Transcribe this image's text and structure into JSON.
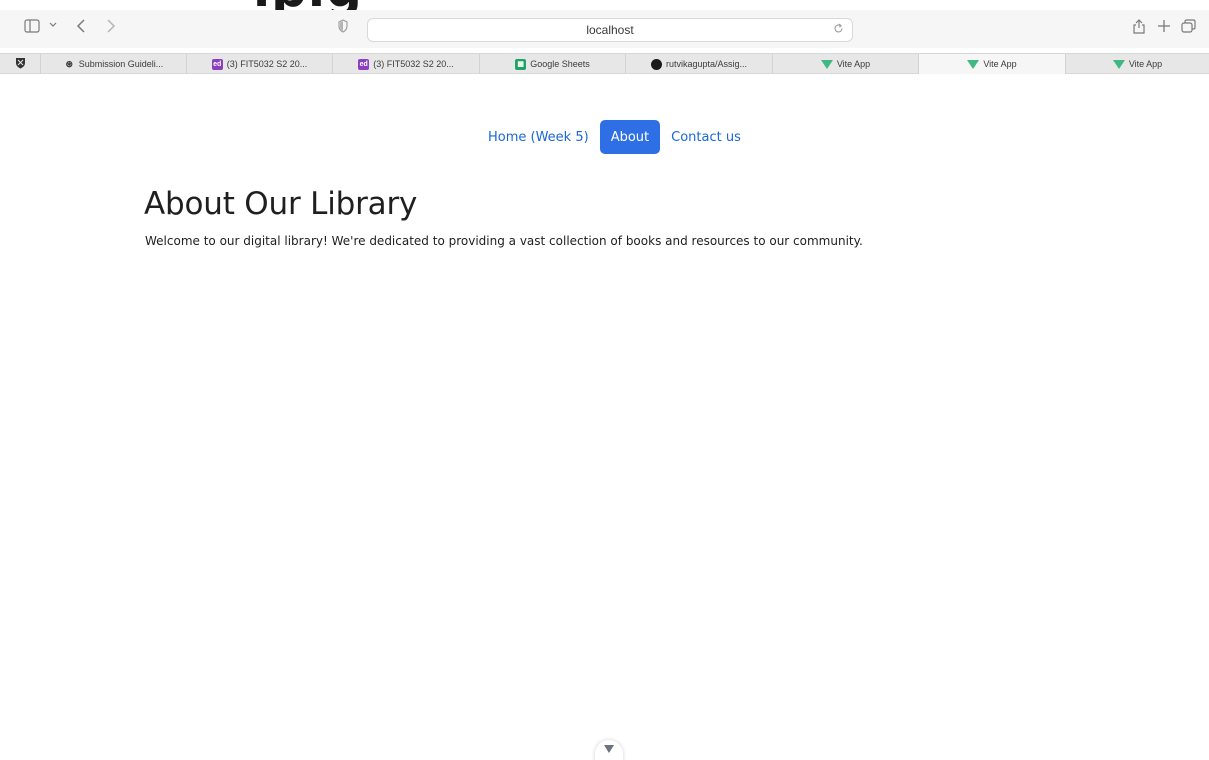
{
  "top_overflow_text": "ipig",
  "browser": {
    "address": "localhost",
    "icons": {
      "sidebar": "sidebar-icon",
      "chevron": "chevron-down-icon",
      "back": "back-arrow-icon",
      "forward": "forward-arrow-icon",
      "shield": "privacy-shield-icon",
      "reload": "reload-icon",
      "share": "share-icon",
      "new_tab": "plus-icon",
      "tabs_overview": "tab-overview-icon"
    },
    "tabs": [
      {
        "label": "Submission Guideli...",
        "icon": "chatgpt-icon"
      },
      {
        "label": "(3) FIT5032 S2 20...",
        "icon": "ed-icon"
      },
      {
        "label": "(3) FIT5032 S2 20...",
        "icon": "ed-icon"
      },
      {
        "label": "Google Sheets",
        "icon": "google-sheets-icon"
      },
      {
        "label": "rutvikagupta/Assig...",
        "icon": "github-icon"
      },
      {
        "label": "Vite App",
        "icon": "vue-icon"
      },
      {
        "label": "Vite App",
        "icon": "vue-icon"
      },
      {
        "label": "Vite App",
        "icon": "vue-icon"
      }
    ]
  },
  "nav": {
    "home": "Home (Week 5)",
    "about": "About",
    "contact": "Contact us"
  },
  "main": {
    "title": "About Our Library",
    "description": "Welcome to our digital library! We're dedicated to providing a vast collection of books and resources to our community."
  },
  "colors": {
    "accent": "#2f6fe6",
    "link": "#1a66d9"
  }
}
